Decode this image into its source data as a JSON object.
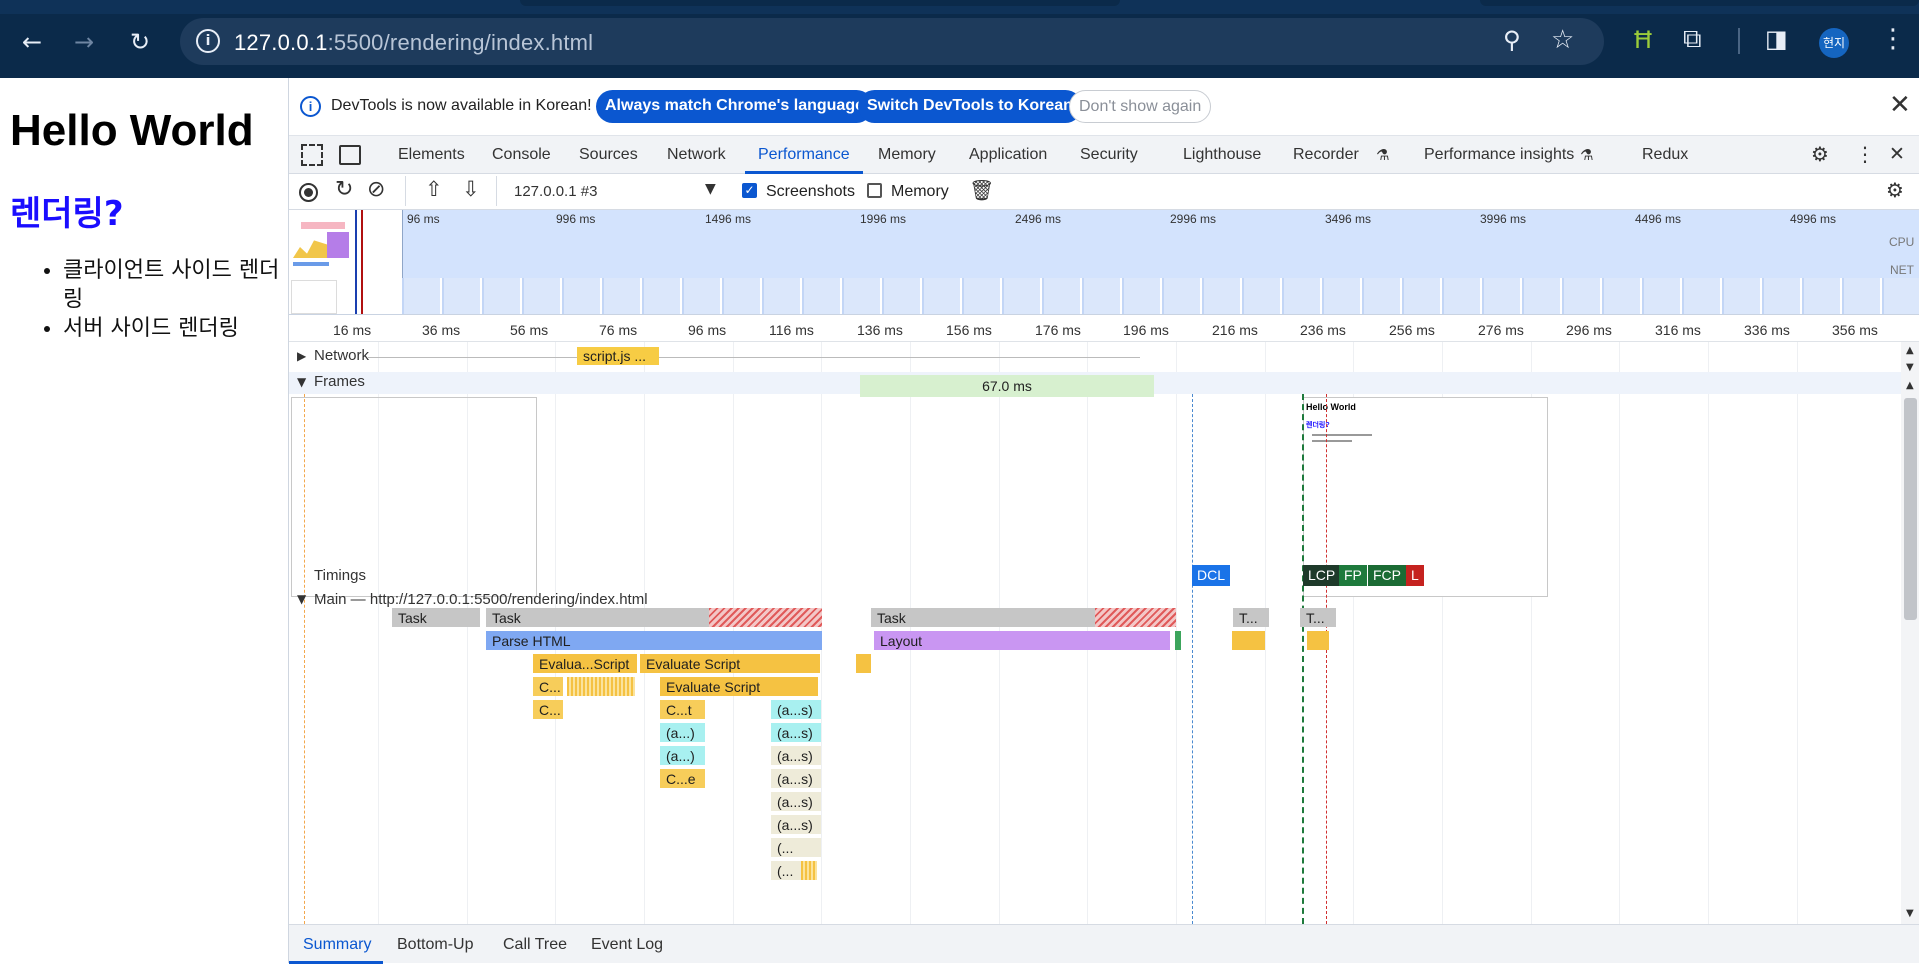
{
  "browser": {
    "url_host": "127.0.0.1",
    "url_rest": ":5500/rendering/index.html",
    "profile_label": "현지",
    "colors": {
      "frame": "#0b2a4a",
      "omnibox": "#1e3b5c",
      "accent": "#0b57d0"
    }
  },
  "page": {
    "heading": "Hello World",
    "subheading": "렌더링?",
    "list": [
      "클라이언트 사이드 렌더링",
      "서버 사이드 렌더링"
    ]
  },
  "devtools": {
    "infobar": {
      "message": "DevTools is now available in Korean!",
      "btn_match": "Always match Chrome's language",
      "btn_switch": "Switch DevTools to Korean",
      "btn_dismiss": "Don't show again"
    },
    "tabs": [
      "Elements",
      "Console",
      "Sources",
      "Network",
      "Performance",
      "Memory",
      "Application",
      "Security",
      "Lighthouse",
      "Recorder",
      "Performance insights",
      "Redux"
    ],
    "active_tab": "Performance",
    "toolbar": {
      "recording_select": "127.0.0.1 #3",
      "screenshots_label": "Screenshots",
      "screenshots_checked": true,
      "memory_label": "Memory",
      "memory_checked": false
    },
    "overview": {
      "ticks": [
        "96 ms",
        "996 ms",
        "1496 ms",
        "1996 ms",
        "2496 ms",
        "2996 ms",
        "3496 ms",
        "3996 ms",
        "4496 ms",
        "4996 ms"
      ],
      "cpu_label": "CPU",
      "net_label": "NET"
    },
    "ruler_ticks": [
      "16 ms",
      "36 ms",
      "56 ms",
      "76 ms",
      "96 ms",
      "116 ms",
      "136 ms",
      "156 ms",
      "176 ms",
      "196 ms",
      "216 ms",
      "236 ms",
      "256 ms",
      "276 ms",
      "296 ms",
      "316 ms",
      "336 ms",
      "356 ms"
    ],
    "tracks": {
      "network_label": "Network",
      "network_item": "script.js ...",
      "frames_label": "Frames",
      "frame_duration": "67.0 ms",
      "frame_thumb": {
        "heading": "Hello World",
        "subheading": "렌더링?"
      },
      "timings_label": "Timings",
      "timing_markers": [
        {
          "label": "DCL",
          "color": "#1a73e8"
        },
        {
          "label": "LCP",
          "color": "#1e3a2a"
        },
        {
          "label": "FP",
          "color": "#1e7a3c"
        },
        {
          "label": "FCP",
          "color": "#1b6b34"
        },
        {
          "label": "L",
          "color": "#c5221f"
        }
      ],
      "main_label": "Main — http://127.0.0.1:5500/rendering/index.html"
    },
    "flame": {
      "task": "Task",
      "task_short": "T...",
      "parse_html": "Parse HTML",
      "layout": "Layout",
      "evaluate_script": "Evaluate Script",
      "evaluate_script_short": "Evalua...Script",
      "c_short": "C...",
      "ct": "C...t",
      "ce": "C...e",
      "anon_short": "(a...)",
      "anon_s": "(a...s)",
      "paren": "(..."
    },
    "bottom_tabs": [
      "Summary",
      "Bottom-Up",
      "Call Tree",
      "Event Log"
    ],
    "bottom_active": "Summary"
  }
}
